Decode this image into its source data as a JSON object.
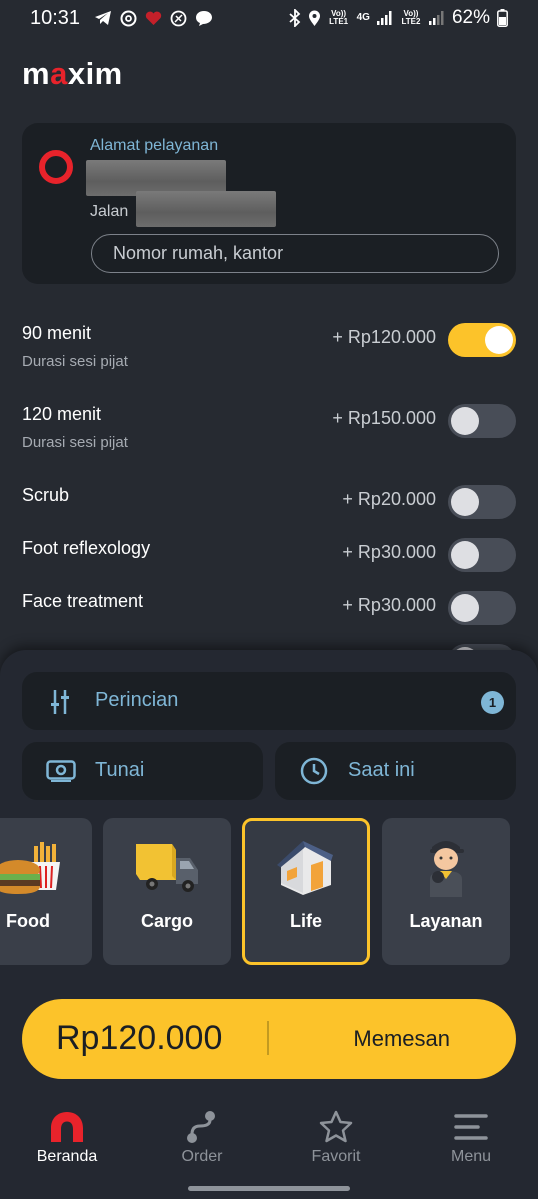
{
  "status_bar": {
    "time": "10:31",
    "battery": "62%",
    "network": "4G",
    "volte1": "Vo)) LTE1",
    "volte2": "Vo)) LTE2",
    "icons_left": [
      "telegram-icon",
      "threads-icon",
      "heart-icon",
      "app-icon",
      "chat-icon"
    ],
    "icons_right": [
      "bluetooth-icon",
      "location-icon",
      "signal-icon",
      "battery-icon"
    ]
  },
  "app": {
    "logo_text_1": "m",
    "logo_text_2": "a",
    "logo_text_3": "xim"
  },
  "address": {
    "label": "Alamat pelayanan",
    "line2_prefix": "Jalan",
    "house_placeholder": "Nomor rumah, kantor"
  },
  "options": [
    {
      "title": "90 menit",
      "subtitle": "Durasi sesi pijat",
      "price": "+ Rp120.000",
      "enabled": true
    },
    {
      "title": "120 menit",
      "subtitle": "Durasi sesi pijat",
      "price": "+ Rp150.000",
      "enabled": false
    },
    {
      "title": "Scrub",
      "subtitle": "",
      "price": "+ Rp20.000",
      "enabled": false
    },
    {
      "title": "Foot reflexology",
      "subtitle": "",
      "price": "+ Rp30.000",
      "enabled": false
    },
    {
      "title": "Face treatment",
      "subtitle": "",
      "price": "+ Rp30.000",
      "enabled": false
    }
  ],
  "sheet": {
    "details_label": "Perincian",
    "details_badge": "1",
    "payment_label": "Tunai",
    "time_label": "Saat ini"
  },
  "services": [
    {
      "name": "Food",
      "selected": false
    },
    {
      "name": "Cargo",
      "selected": false
    },
    {
      "name": "Life",
      "selected": true
    },
    {
      "name": "Layanan",
      "selected": false
    }
  ],
  "order": {
    "price": "Rp120.000",
    "button": "Memesan"
  },
  "nav": [
    {
      "label": "Beranda",
      "active": true
    },
    {
      "label": "Order",
      "active": false
    },
    {
      "label": "Favorit",
      "active": false
    },
    {
      "label": "Menu",
      "active": false
    }
  ],
  "colors": {
    "background": "#262a31",
    "card": "#1b1f24",
    "accent_yellow": "#fcc32a",
    "brand_red": "#e8232b",
    "link_blue": "#7fb6d6"
  }
}
